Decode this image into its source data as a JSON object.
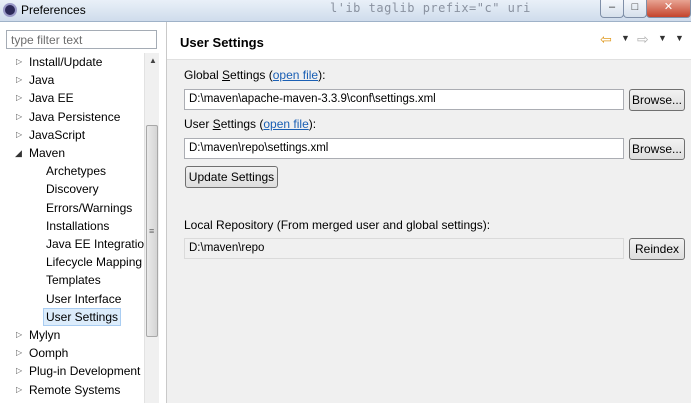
{
  "window": {
    "title": "Preferences",
    "background_code": "l'ib taglib prefix=\"c\" uri",
    "min_label": "–",
    "max_label": "□",
    "close_label": "✕"
  },
  "sidebar": {
    "filter_placeholder": "type filter text",
    "items": [
      {
        "label": "Install/Update",
        "expanded": false
      },
      {
        "label": "Java",
        "expanded": false
      },
      {
        "label": "Java EE",
        "expanded": false
      },
      {
        "label": "Java Persistence",
        "expanded": false
      },
      {
        "label": "JavaScript",
        "expanded": false
      },
      {
        "label": "Maven",
        "expanded": true
      },
      {
        "label": "Archetypes",
        "child": true
      },
      {
        "label": "Discovery",
        "child": true
      },
      {
        "label": "Errors/Warnings",
        "child": true
      },
      {
        "label": "Installations",
        "child": true
      },
      {
        "label": "Java EE Integration",
        "child": true
      },
      {
        "label": "Lifecycle Mapping",
        "child": true
      },
      {
        "label": "Templates",
        "child": true
      },
      {
        "label": "User Interface",
        "child": true
      },
      {
        "label": "User Settings",
        "child": true,
        "selected": true
      },
      {
        "label": "Mylyn",
        "expanded": false
      },
      {
        "label": "Oomph",
        "expanded": false
      },
      {
        "label": "Plug-in Development",
        "expanded": false
      },
      {
        "label": "Remote Systems",
        "expanded": false
      }
    ]
  },
  "main": {
    "title": "User Settings",
    "global_settings": {
      "label_prefix": "Global ",
      "label_accel": "S",
      "label_rest": "ettings (",
      "link": "open file",
      "label_suffix": "):",
      "value": "D:\\maven\\apache-maven-3.3.9\\conf\\settings.xml",
      "browse_label": "Browse..."
    },
    "user_settings": {
      "label_prefix": "User ",
      "label_accel": "S",
      "label_rest": "ettings (",
      "link": "open file",
      "label_suffix": "):",
      "value": "D:\\maven\\repo\\settings.xml",
      "browse_label": "Browse..."
    },
    "update_button": "Update Settings",
    "local_repo": {
      "label": "Local Repository (From merged user and global settings):",
      "value": "D:\\maven\\repo",
      "reindex_label": "Reindex"
    }
  },
  "colors": {
    "link": "#1a5fb4",
    "selection": "#dcecfb",
    "back_arrow": "#e09a20"
  }
}
